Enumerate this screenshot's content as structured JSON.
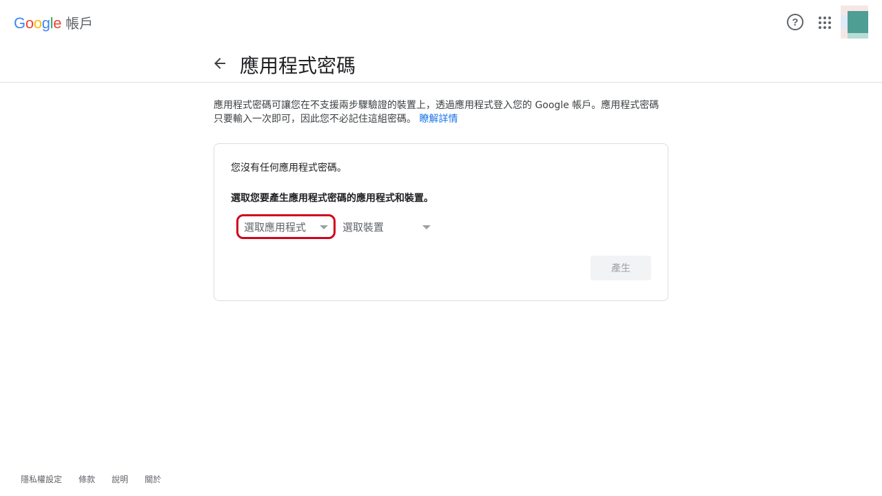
{
  "header": {
    "logo_letters": [
      {
        "char": "G",
        "color": "#4285F4"
      },
      {
        "char": "o",
        "color": "#EA4335"
      },
      {
        "char": "o",
        "color": "#FBBC05"
      },
      {
        "char": "g",
        "color": "#4285F4"
      },
      {
        "char": "l",
        "color": "#34A853"
      },
      {
        "char": "e",
        "color": "#EA4335"
      }
    ],
    "product_name": "帳戶",
    "help_icon": "?",
    "icons": [
      "help-circle-icon",
      "apps-grid-icon",
      "avatar"
    ]
  },
  "title_bar": {
    "back_icon": "arrow-left-icon",
    "title": "應用程式密碼"
  },
  "description": {
    "text": "應用程式密碼可讓您在不支援兩步驟驗證的裝置上，透過應用程式登入您的 Google 帳戶。應用程式密碼只要輸入一次即可，因此您不必記住這組密碼。",
    "link": "瞭解詳情"
  },
  "card": {
    "empty_message": "您沒有任何應用程式密碼。",
    "instruction": "選取您要產生應用程式密碼的應用程式和裝置。",
    "select_app": "選取應用程式",
    "select_device": "選取裝置",
    "generate_button": "產生"
  },
  "footer": {
    "links": [
      "隱私權設定",
      "條款",
      "說明",
      "關於"
    ]
  },
  "colors": {
    "link": "#1a73e8",
    "highlight_border": "#d0021b",
    "divider": "#dadce0"
  }
}
